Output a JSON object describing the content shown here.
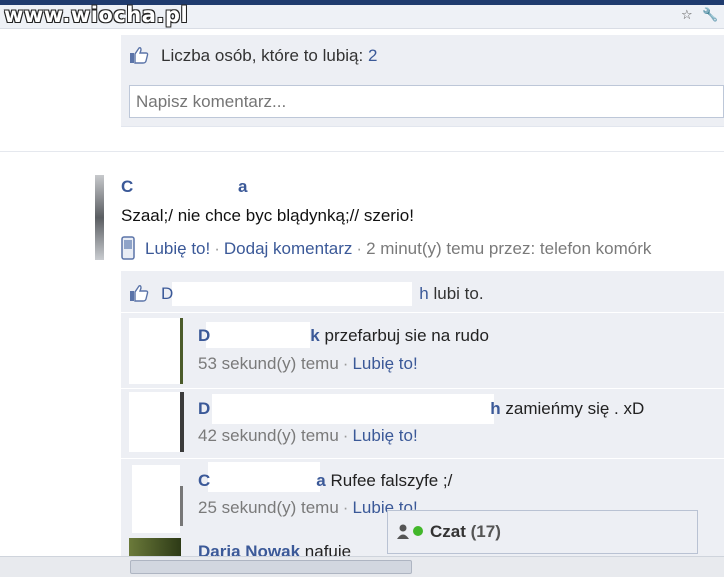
{
  "watermark": "www.wiocha.pl",
  "browser": {
    "star_icon": "star-icon",
    "wrench_icon": "wrench-icon"
  },
  "post1": {
    "likes_label": "Liczba osób, które to lubią:",
    "likes_count": "2",
    "comment_placeholder": "Napisz komentarz..."
  },
  "post2": {
    "author_first": "C",
    "author_last": "a",
    "text": "Szaal;/ nie chce byc blądynką;// szerio!",
    "like_link": "Lubię to!",
    "comment_link": "Dodaj komentarz",
    "meta": "2 minut(y) temu przez: telefon komórk",
    "liked_by_first": "D",
    "liked_by_last": "h",
    "liked_suffix": "lubi to.",
    "comments": [
      {
        "name_first": "D",
        "name_last": "k",
        "text": "przefarbuj sie na rudo",
        "time": "53 sekund(y) temu",
        "like": "Lubię to!"
      },
      {
        "name_first": "D",
        "name_last": "h",
        "text": "zamieńmy się . xD",
        "time": "42 sekund(y) temu",
        "like": "Lubię to!"
      },
      {
        "name_first": "C",
        "name_last": "a",
        "text": "Rufee falszyfe ;/",
        "time": "25 sekund(y) temu",
        "like": "Lubię to!"
      },
      {
        "name": "Daria Nowak",
        "text": "nafuje"
      }
    ]
  },
  "chat": {
    "label": "Czat",
    "count": "(17)"
  },
  "colors": {
    "link": "#3b5998",
    "box_bg": "#edeff4",
    "border": "#bdc7d8"
  }
}
